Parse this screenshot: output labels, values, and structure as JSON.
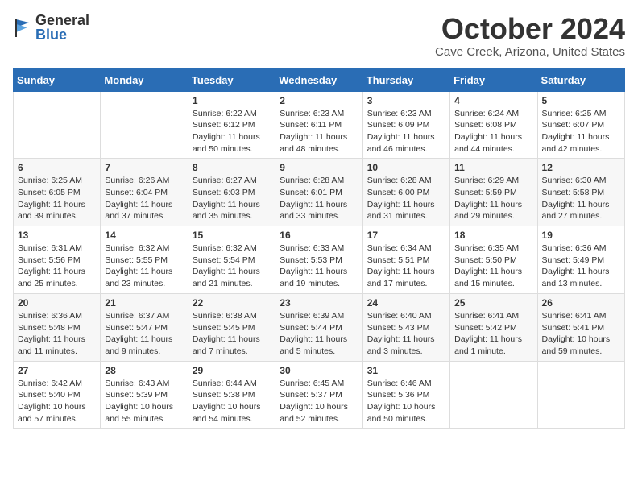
{
  "header": {
    "logo_general": "General",
    "logo_blue": "Blue",
    "month": "October 2024",
    "location": "Cave Creek, Arizona, United States"
  },
  "weekdays": [
    "Sunday",
    "Monday",
    "Tuesday",
    "Wednesday",
    "Thursday",
    "Friday",
    "Saturday"
  ],
  "weeks": [
    [
      {
        "day": "",
        "info": ""
      },
      {
        "day": "",
        "info": ""
      },
      {
        "day": "1",
        "info": "Sunrise: 6:22 AM\nSunset: 6:12 PM\nDaylight: 11 hours and 50 minutes."
      },
      {
        "day": "2",
        "info": "Sunrise: 6:23 AM\nSunset: 6:11 PM\nDaylight: 11 hours and 48 minutes."
      },
      {
        "day": "3",
        "info": "Sunrise: 6:23 AM\nSunset: 6:09 PM\nDaylight: 11 hours and 46 minutes."
      },
      {
        "day": "4",
        "info": "Sunrise: 6:24 AM\nSunset: 6:08 PM\nDaylight: 11 hours and 44 minutes."
      },
      {
        "day": "5",
        "info": "Sunrise: 6:25 AM\nSunset: 6:07 PM\nDaylight: 11 hours and 42 minutes."
      }
    ],
    [
      {
        "day": "6",
        "info": "Sunrise: 6:25 AM\nSunset: 6:05 PM\nDaylight: 11 hours and 39 minutes."
      },
      {
        "day": "7",
        "info": "Sunrise: 6:26 AM\nSunset: 6:04 PM\nDaylight: 11 hours and 37 minutes."
      },
      {
        "day": "8",
        "info": "Sunrise: 6:27 AM\nSunset: 6:03 PM\nDaylight: 11 hours and 35 minutes."
      },
      {
        "day": "9",
        "info": "Sunrise: 6:28 AM\nSunset: 6:01 PM\nDaylight: 11 hours and 33 minutes."
      },
      {
        "day": "10",
        "info": "Sunrise: 6:28 AM\nSunset: 6:00 PM\nDaylight: 11 hours and 31 minutes."
      },
      {
        "day": "11",
        "info": "Sunrise: 6:29 AM\nSunset: 5:59 PM\nDaylight: 11 hours and 29 minutes."
      },
      {
        "day": "12",
        "info": "Sunrise: 6:30 AM\nSunset: 5:58 PM\nDaylight: 11 hours and 27 minutes."
      }
    ],
    [
      {
        "day": "13",
        "info": "Sunrise: 6:31 AM\nSunset: 5:56 PM\nDaylight: 11 hours and 25 minutes."
      },
      {
        "day": "14",
        "info": "Sunrise: 6:32 AM\nSunset: 5:55 PM\nDaylight: 11 hours and 23 minutes."
      },
      {
        "day": "15",
        "info": "Sunrise: 6:32 AM\nSunset: 5:54 PM\nDaylight: 11 hours and 21 minutes."
      },
      {
        "day": "16",
        "info": "Sunrise: 6:33 AM\nSunset: 5:53 PM\nDaylight: 11 hours and 19 minutes."
      },
      {
        "day": "17",
        "info": "Sunrise: 6:34 AM\nSunset: 5:51 PM\nDaylight: 11 hours and 17 minutes."
      },
      {
        "day": "18",
        "info": "Sunrise: 6:35 AM\nSunset: 5:50 PM\nDaylight: 11 hours and 15 minutes."
      },
      {
        "day": "19",
        "info": "Sunrise: 6:36 AM\nSunset: 5:49 PM\nDaylight: 11 hours and 13 minutes."
      }
    ],
    [
      {
        "day": "20",
        "info": "Sunrise: 6:36 AM\nSunset: 5:48 PM\nDaylight: 11 hours and 11 minutes."
      },
      {
        "day": "21",
        "info": "Sunrise: 6:37 AM\nSunset: 5:47 PM\nDaylight: 11 hours and 9 minutes."
      },
      {
        "day": "22",
        "info": "Sunrise: 6:38 AM\nSunset: 5:45 PM\nDaylight: 11 hours and 7 minutes."
      },
      {
        "day": "23",
        "info": "Sunrise: 6:39 AM\nSunset: 5:44 PM\nDaylight: 11 hours and 5 minutes."
      },
      {
        "day": "24",
        "info": "Sunrise: 6:40 AM\nSunset: 5:43 PM\nDaylight: 11 hours and 3 minutes."
      },
      {
        "day": "25",
        "info": "Sunrise: 6:41 AM\nSunset: 5:42 PM\nDaylight: 11 hours and 1 minute."
      },
      {
        "day": "26",
        "info": "Sunrise: 6:41 AM\nSunset: 5:41 PM\nDaylight: 10 hours and 59 minutes."
      }
    ],
    [
      {
        "day": "27",
        "info": "Sunrise: 6:42 AM\nSunset: 5:40 PM\nDaylight: 10 hours and 57 minutes."
      },
      {
        "day": "28",
        "info": "Sunrise: 6:43 AM\nSunset: 5:39 PM\nDaylight: 10 hours and 55 minutes."
      },
      {
        "day": "29",
        "info": "Sunrise: 6:44 AM\nSunset: 5:38 PM\nDaylight: 10 hours and 54 minutes."
      },
      {
        "day": "30",
        "info": "Sunrise: 6:45 AM\nSunset: 5:37 PM\nDaylight: 10 hours and 52 minutes."
      },
      {
        "day": "31",
        "info": "Sunrise: 6:46 AM\nSunset: 5:36 PM\nDaylight: 10 hours and 50 minutes."
      },
      {
        "day": "",
        "info": ""
      },
      {
        "day": "",
        "info": ""
      }
    ]
  ]
}
